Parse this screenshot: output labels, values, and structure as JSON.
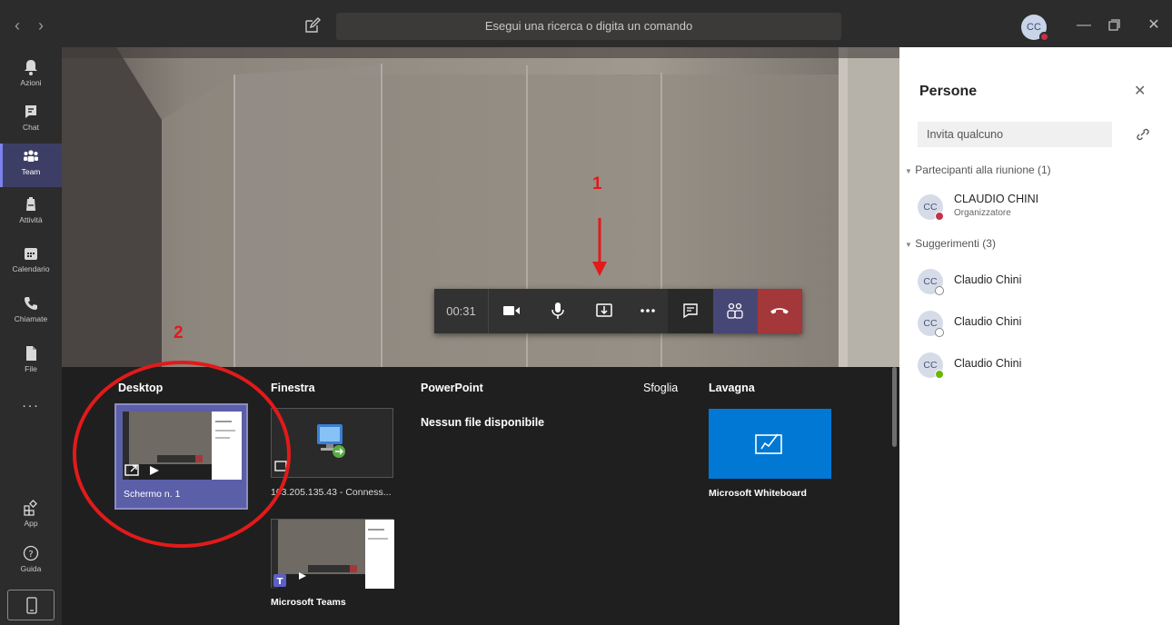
{
  "titlebar": {
    "search_placeholder": "Esegui una ricerca o digita un comando",
    "avatar_initials": "CC"
  },
  "rail": {
    "items": [
      {
        "label": "Azioni",
        "icon": "bell-icon"
      },
      {
        "label": "Chat",
        "icon": "chat-icon"
      },
      {
        "label": "Team",
        "icon": "team-icon"
      },
      {
        "label": "Attività",
        "icon": "assignments-icon"
      },
      {
        "label": "Calendario",
        "icon": "calendar-icon"
      },
      {
        "label": "Chiamate",
        "icon": "phone-icon"
      },
      {
        "label": "File",
        "icon": "file-icon"
      }
    ],
    "more": "...",
    "app_label": "App",
    "help_label": "Guida",
    "active": "Team"
  },
  "call": {
    "timer": "00:31"
  },
  "tray": {
    "categories": {
      "desktop": "Desktop",
      "window": "Finestra",
      "powerpoint": "PowerPoint",
      "browse": "Sfoglia",
      "whiteboard": "Lavagna"
    },
    "desktop_item": "Schermo n. 1",
    "window_item": "103.205.135.43 - Conness...",
    "teams_item": "Microsoft Teams",
    "no_files": "Nessun file disponibile",
    "whiteboard_item": "Microsoft Whiteboard"
  },
  "people": {
    "title": "Persone",
    "invite_placeholder": "Invita qualcuno",
    "participants_header": "Partecipanti alla riunione (1)",
    "suggestions_header": "Suggerimenti (3)",
    "participant": {
      "initials": "CC",
      "name": "CLAUDIO CHINI",
      "role": "Organizzatore",
      "status_color": "#c4314b"
    },
    "suggestions": [
      {
        "initials": "CC",
        "name": "Claudio Chini",
        "status": "offline"
      },
      {
        "initials": "CC",
        "name": "Claudio Chini",
        "status": "offline"
      },
      {
        "initials": "CC",
        "name": "Claudio Chini",
        "status": "available"
      }
    ]
  },
  "annotations": {
    "one": "1",
    "two": "2"
  },
  "colors": {
    "accent": "#464775",
    "hangup": "#a4373a",
    "annotation": "#e21a1a",
    "whiteboard": "#0078d4"
  }
}
